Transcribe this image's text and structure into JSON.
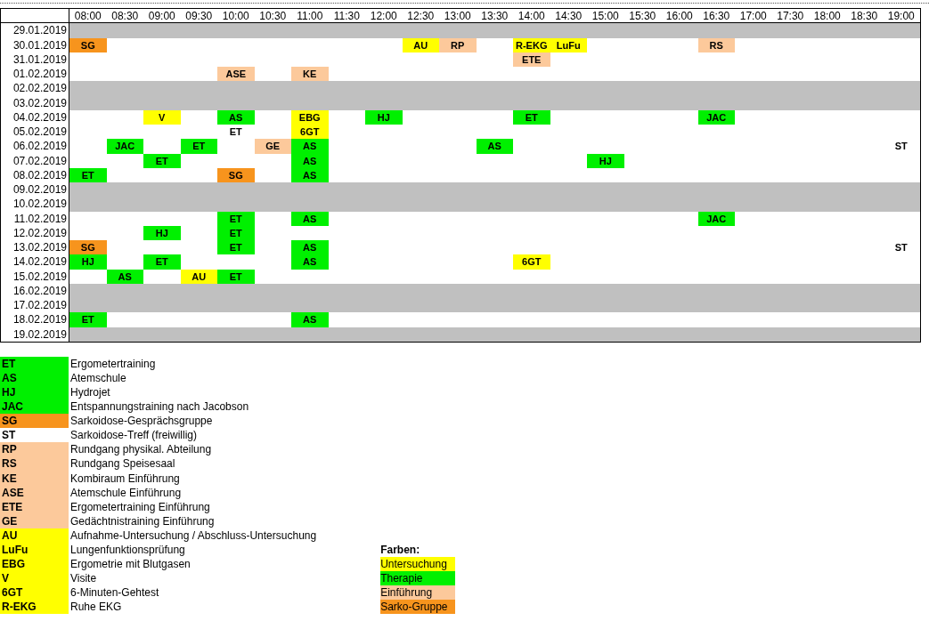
{
  "schedule": {
    "times": [
      "08:00",
      "08:30",
      "09:00",
      "09:30",
      "10:00",
      "10:30",
      "11:00",
      "11:30",
      "12:00",
      "12:30",
      "13:00",
      "13:30",
      "14:00",
      "14:30",
      "15:00",
      "15:30",
      "16:00",
      "16:30",
      "17:00",
      "17:30",
      "18:00",
      "18:30",
      "19:00"
    ],
    "rows": [
      {
        "date": "29.01.2019",
        "shaded": true
      },
      {
        "date": "30.01.2019",
        "slots": [
          {
            "kind": "event",
            "code": "SG",
            "color": "#f7941d"
          },
          {
            "kind": "empty"
          },
          {
            "kind": "empty"
          },
          {
            "kind": "empty"
          },
          {
            "kind": "empty"
          },
          {
            "kind": "empty"
          },
          {
            "kind": "empty"
          },
          {
            "kind": "empty"
          },
          {
            "kind": "empty"
          },
          {
            "kind": "event",
            "code": "AU",
            "color": "#ffff00"
          },
          {
            "kind": "event",
            "code": "RP",
            "color": "#fcc99b"
          },
          {
            "kind": "empty"
          },
          {
            "kind": "event",
            "code": "R-EKG",
            "color": "#ffff00"
          },
          {
            "kind": "event",
            "code": "LuFu",
            "color": "#ffff00"
          },
          {
            "kind": "empty"
          },
          {
            "kind": "empty"
          },
          {
            "kind": "empty"
          },
          {
            "kind": "event",
            "code": "RS",
            "color": "#fcc99b"
          }
        ]
      },
      {
        "date": "31.01.2019",
        "slots": [
          {
            "kind": "empty"
          },
          {
            "kind": "empty"
          },
          {
            "kind": "empty"
          },
          {
            "kind": "empty"
          },
          {
            "kind": "empty"
          },
          {
            "kind": "empty"
          },
          {
            "kind": "empty"
          },
          {
            "kind": "empty"
          },
          {
            "kind": "empty"
          },
          {
            "kind": "empty"
          },
          {
            "kind": "empty"
          },
          {
            "kind": "empty"
          },
          {
            "kind": "event",
            "code": "ETE",
            "color": "#fcc99b"
          }
        ]
      },
      {
        "date": "01.02.2019",
        "slots": [
          {
            "kind": "empty"
          },
          {
            "kind": "empty"
          },
          {
            "kind": "empty"
          },
          {
            "kind": "empty"
          },
          {
            "kind": "event",
            "code": "ASE",
            "color": "#fcc99b"
          },
          {
            "kind": "empty"
          },
          {
            "kind": "event",
            "code": "KE",
            "color": "#fcc99b"
          }
        ]
      },
      {
        "date": "02.02.2019",
        "shaded": true
      },
      {
        "date": "03.02.2019",
        "shaded": true
      },
      {
        "date": "04.02.2019",
        "slots": [
          {
            "kind": "empty"
          },
          {
            "kind": "empty"
          },
          {
            "kind": "event",
            "code": "V",
            "color": "#ffff00"
          },
          {
            "kind": "empty"
          },
          {
            "kind": "event",
            "code": "AS",
            "color": "#00f000"
          },
          {
            "kind": "empty"
          },
          {
            "kind": "event",
            "code": "EBG",
            "color": "#ffff00"
          },
          {
            "kind": "empty"
          },
          {
            "kind": "event",
            "code": "HJ",
            "color": "#00f000"
          },
          {
            "kind": "empty"
          },
          {
            "kind": "empty"
          },
          {
            "kind": "empty"
          },
          {
            "kind": "event",
            "code": "ET",
            "color": "#00f000"
          },
          {
            "kind": "empty"
          },
          {
            "kind": "empty"
          },
          {
            "kind": "empty"
          },
          {
            "kind": "empty"
          },
          {
            "kind": "event",
            "code": "JAC",
            "color": "#00f000"
          }
        ]
      },
      {
        "date": "05.02.2019",
        "slots": [
          {
            "kind": "empty"
          },
          {
            "kind": "empty"
          },
          {
            "kind": "empty"
          },
          {
            "kind": "empty"
          },
          {
            "kind": "event",
            "code": "ET",
            "color": "#ffffff"
          },
          {
            "kind": "empty"
          },
          {
            "kind": "event",
            "code": "6GT",
            "color": "#ffff00"
          }
        ]
      },
      {
        "date": "06.02.2019",
        "slots": [
          {
            "kind": "empty"
          },
          {
            "kind": "event",
            "code": "JAC",
            "color": "#00f000"
          },
          {
            "kind": "empty"
          },
          {
            "kind": "event",
            "code": "ET",
            "color": "#00f000"
          },
          {
            "kind": "empty"
          },
          {
            "kind": "event",
            "code": "GE",
            "color": "#fcc99b"
          },
          {
            "kind": "event",
            "code": "AS",
            "color": "#00f000"
          },
          {
            "kind": "empty"
          },
          {
            "kind": "empty"
          },
          {
            "kind": "empty"
          },
          {
            "kind": "empty"
          },
          {
            "kind": "event",
            "code": "AS",
            "color": "#00f000"
          },
          {
            "kind": "empty"
          },
          {
            "kind": "empty"
          },
          {
            "kind": "empty"
          },
          {
            "kind": "empty"
          },
          {
            "kind": "empty"
          },
          {
            "kind": "empty"
          },
          {
            "kind": "empty"
          },
          {
            "kind": "empty"
          },
          {
            "kind": "empty"
          },
          {
            "kind": "empty"
          },
          {
            "kind": "event",
            "code": "ST",
            "color": "#ffffff"
          }
        ]
      },
      {
        "date": "07.02.2019",
        "slots": [
          {
            "kind": "empty"
          },
          {
            "kind": "empty"
          },
          {
            "kind": "event",
            "code": "ET",
            "color": "#00f000"
          },
          {
            "kind": "empty"
          },
          {
            "kind": "empty"
          },
          {
            "kind": "empty"
          },
          {
            "kind": "event",
            "code": "AS",
            "color": "#00f000"
          },
          {
            "kind": "empty"
          },
          {
            "kind": "empty"
          },
          {
            "kind": "empty"
          },
          {
            "kind": "empty"
          },
          {
            "kind": "empty"
          },
          {
            "kind": "empty"
          },
          {
            "kind": "empty"
          },
          {
            "kind": "event",
            "code": "HJ",
            "color": "#00f000"
          }
        ]
      },
      {
        "date": "08.02.2019",
        "slots": [
          {
            "kind": "event",
            "code": "ET",
            "color": "#00f000"
          },
          {
            "kind": "empty"
          },
          {
            "kind": "empty"
          },
          {
            "kind": "empty"
          },
          {
            "kind": "event",
            "code": "SG",
            "color": "#f7941d"
          },
          {
            "kind": "empty"
          },
          {
            "kind": "event",
            "code": "AS",
            "color": "#00f000"
          }
        ]
      },
      {
        "date": "09.02.2019",
        "shaded": true
      },
      {
        "date": "10.02.2019",
        "shaded": true
      },
      {
        "date": "11.02.2019",
        "slots": [
          {
            "kind": "empty"
          },
          {
            "kind": "empty"
          },
          {
            "kind": "empty"
          },
          {
            "kind": "empty"
          },
          {
            "kind": "event",
            "code": "ET",
            "color": "#00f000"
          },
          {
            "kind": "empty"
          },
          {
            "kind": "event",
            "code": "AS",
            "color": "#00f000"
          },
          {
            "kind": "empty"
          },
          {
            "kind": "empty"
          },
          {
            "kind": "empty"
          },
          {
            "kind": "empty"
          },
          {
            "kind": "empty"
          },
          {
            "kind": "empty"
          },
          {
            "kind": "empty"
          },
          {
            "kind": "empty"
          },
          {
            "kind": "empty"
          },
          {
            "kind": "empty"
          },
          {
            "kind": "event",
            "code": "JAC",
            "color": "#00f000"
          }
        ]
      },
      {
        "date": "12.02.2019",
        "slots": [
          {
            "kind": "empty"
          },
          {
            "kind": "empty"
          },
          {
            "kind": "event",
            "code": "HJ",
            "color": "#00f000"
          },
          {
            "kind": "empty"
          },
          {
            "kind": "event",
            "code": "ET",
            "color": "#00f000"
          }
        ]
      },
      {
        "date": "13.02.2019",
        "slots": [
          {
            "kind": "event",
            "code": "SG",
            "color": "#f7941d"
          },
          {
            "kind": "empty"
          },
          {
            "kind": "empty"
          },
          {
            "kind": "empty"
          },
          {
            "kind": "event",
            "code": "ET",
            "color": "#00f000"
          },
          {
            "kind": "empty"
          },
          {
            "kind": "event",
            "code": "AS",
            "color": "#00f000"
          },
          {
            "kind": "empty"
          },
          {
            "kind": "empty"
          },
          {
            "kind": "empty"
          },
          {
            "kind": "empty"
          },
          {
            "kind": "empty"
          },
          {
            "kind": "empty"
          },
          {
            "kind": "empty"
          },
          {
            "kind": "empty"
          },
          {
            "kind": "empty"
          },
          {
            "kind": "empty"
          },
          {
            "kind": "empty"
          },
          {
            "kind": "empty"
          },
          {
            "kind": "empty"
          },
          {
            "kind": "empty"
          },
          {
            "kind": "empty"
          },
          {
            "kind": "event",
            "code": "ST",
            "color": "#ffffff"
          }
        ]
      },
      {
        "date": "14.02.2019",
        "slots": [
          {
            "kind": "event",
            "code": "HJ",
            "color": "#00f000"
          },
          {
            "kind": "empty"
          },
          {
            "kind": "event",
            "code": "ET",
            "color": "#00f000"
          },
          {
            "kind": "empty"
          },
          {
            "kind": "empty"
          },
          {
            "kind": "empty"
          },
          {
            "kind": "event",
            "code": "AS",
            "color": "#00f000"
          },
          {
            "kind": "empty"
          },
          {
            "kind": "empty"
          },
          {
            "kind": "empty"
          },
          {
            "kind": "empty"
          },
          {
            "kind": "empty"
          },
          {
            "kind": "event",
            "code": "6GT",
            "color": "#ffff00"
          }
        ]
      },
      {
        "date": "15.02.2019",
        "slots": [
          {
            "kind": "empty"
          },
          {
            "kind": "event",
            "code": "AS",
            "color": "#00f000"
          },
          {
            "kind": "empty"
          },
          {
            "kind": "event",
            "code": "AU",
            "color": "#ffff00"
          },
          {
            "kind": "event",
            "code": "ET",
            "color": "#00f000"
          }
        ]
      },
      {
        "date": "16.02.2019",
        "shaded": true
      },
      {
        "date": "17.02.2019",
        "shaded": true
      },
      {
        "date": "18.02.2019",
        "slots": [
          {
            "kind": "event",
            "code": "ET",
            "color": "#00f000"
          },
          {
            "kind": "empty"
          },
          {
            "kind": "empty"
          },
          {
            "kind": "empty"
          },
          {
            "kind": "empty"
          },
          {
            "kind": "empty"
          },
          {
            "kind": "event",
            "code": "AS",
            "color": "#00f000"
          }
        ]
      },
      {
        "date": "19.02.2019",
        "shaded": true
      }
    ]
  },
  "legend": [
    {
      "code": "ET",
      "description": "Ergometertraining",
      "color": "#00f000"
    },
    {
      "code": "AS",
      "description": "Atemschule",
      "color": "#00f000"
    },
    {
      "code": "HJ",
      "description": "Hydrojet",
      "color": "#00f000"
    },
    {
      "code": "JAC",
      "description": "Entspannungstraining nach Jacobson",
      "color": "#00f000"
    },
    {
      "code": "SG",
      "description": "Sarkoidose-Gesprächsgruppe",
      "color": "#f7941d"
    },
    {
      "code": "ST",
      "description": "Sarkoidose-Treff (freiwillig)",
      "color": "#ffffff"
    },
    {
      "code": "RP",
      "description": "Rundgang physikal. Abteilung",
      "color": "#fcc99b"
    },
    {
      "code": "RS",
      "description": "Rundgang Speisesaal",
      "color": "#fcc99b"
    },
    {
      "code": "KE",
      "description": "Kombiraum Einführung",
      "color": "#fcc99b"
    },
    {
      "code": "ASE",
      "description": "Atemschule Einführung",
      "color": "#fcc99b"
    },
    {
      "code": "ETE",
      "description": "Ergometertraining Einführung",
      "color": "#fcc99b"
    },
    {
      "code": "GE",
      "description": "Gedächtnistraining Einführung",
      "color": "#fcc99b"
    },
    {
      "code": "AU",
      "description": "Aufnahme-Untersuchung / Abschluss-Untersuchung",
      "color": "#ffff00"
    },
    {
      "code": "LuFu",
      "description": "Lungenfunktionsprüfung",
      "color": "#ffff00"
    },
    {
      "code": "EBG",
      "description": "Ergometrie mit Blutgasen",
      "color": "#ffff00"
    },
    {
      "code": "V",
      "description": "Visite",
      "color": "#ffff00"
    },
    {
      "code": "6GT",
      "description": "6-Minuten-Gehtest",
      "color": "#ffff00"
    },
    {
      "code": "R-EKG",
      "description": "Ruhe EKG",
      "color": "#ffff00"
    }
  ],
  "colors": {
    "title": "Farben:",
    "items": [
      {
        "label": "Untersuchung",
        "color": "#ffff00"
      },
      {
        "label": "Therapie",
        "color": "#00f000"
      },
      {
        "label": "Einführung",
        "color": "#fcc99b"
      },
      {
        "label": "Sarko-Gruppe",
        "color": "#f7941d"
      }
    ]
  }
}
